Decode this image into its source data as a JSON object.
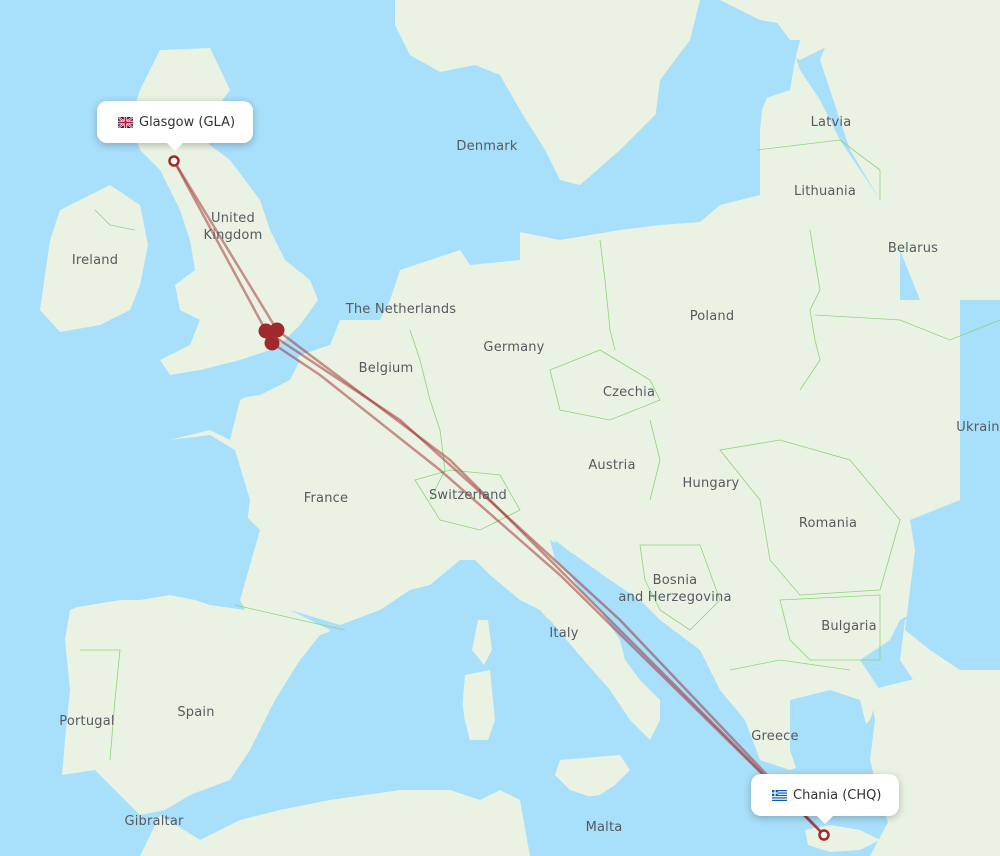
{
  "map": {
    "origin": {
      "city": "Glasgow",
      "code": "GLA",
      "label": "Glasgow (GLA)",
      "flag": "uk-flag-icon"
    },
    "destination": {
      "city": "Chania",
      "code": "CHQ",
      "label": "Chania (CHQ)",
      "flag": "greece-flag-icon"
    },
    "route_color": "#a0292b",
    "layover_markers": 3,
    "countries": [
      {
        "name": "Ireland"
      },
      {
        "name": "United\nKingdom"
      },
      {
        "name": "Denmark"
      },
      {
        "name": "Latvia"
      },
      {
        "name": "Lithuania"
      },
      {
        "name": "Belarus"
      },
      {
        "name": "The Netherlands"
      },
      {
        "name": "Poland"
      },
      {
        "name": "Germany"
      },
      {
        "name": "Belgium"
      },
      {
        "name": "Czechia"
      },
      {
        "name": "Ukrain"
      },
      {
        "name": "Austria"
      },
      {
        "name": "Hungary"
      },
      {
        "name": "France"
      },
      {
        "name": "Switzerland"
      },
      {
        "name": "Romania"
      },
      {
        "name": "Bosnia\nand Herzegovina"
      },
      {
        "name": "Bulgaria"
      },
      {
        "name": "Italy"
      },
      {
        "name": "Spain"
      },
      {
        "name": "Portugal"
      },
      {
        "name": "Greece"
      },
      {
        "name": "Gibraltar"
      },
      {
        "name": "Malta"
      }
    ]
  }
}
